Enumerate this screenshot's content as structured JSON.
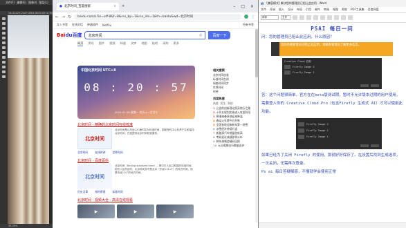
{
  "photoshop": {
    "menu": [
      "文件(F)",
      "编辑(E)",
      "图像(I)",
      "图层(L)",
      "文字(Y)",
      "选择(S)"
    ],
    "doc_title": "34c2a426-2ae0-4964-8b09-857a-3b6fbe57ec70.jpg",
    "zoom": "33.33%",
    "status": "1440 像素 x 2560 像素"
  },
  "browser": {
    "tab_title": "北京时间_百度搜索",
    "url": "baidu.com/s?ie=utf-8&f=8&rsv_bp=1&rsv_idx=1&tn=baidu&wd=北京时间",
    "bookmarks": [
      "导入书签",
      "在线对话",
      "神器插件",
      "Netflix"
    ],
    "bookmarks_right": "所有书签",
    "logo_a": "Bai",
    "logo_b": "du百度",
    "search_value": "北京时间",
    "search_button": "百度一下",
    "nav_tabs": [
      "网页",
      "资讯",
      "图片",
      "视频",
      "知道",
      "文库",
      "地图",
      "贴吧",
      "采购",
      "更多"
    ],
    "clock": {
      "title": "中国北京时间 UTC+8",
      "time": "08 : 20 : 57",
      "date": "2024-01-08 星期一 农历十一月廿七"
    },
    "result1": {
      "title": "北京时间 - 精确的北京时间在线校准",
      "img": "北京时间",
      "text": "北京时间是以东经120度时区为标准时间，国家授时中心负责产生和保持北京时间，在线提供北京时间校准服务。",
      "links": [
        "北京时间",
        "在线时钟",
        "世界时间"
      ]
    },
    "result2": {
      "title": "北京时间 - 百度百科",
      "img": "北京时间",
      "text": "北京时间（Beijing standard time），是中华人民共和国的标准时间，即东八区的区时。北京时间并不是北京（东经116.4°）的地方时间，而是东经120°的地方时间。",
      "links": [
        "历史沿革",
        "授时原理",
        "标准时间"
      ]
    },
    "result3": {
      "title": "北京时间 - 视频大全 - 高清在线观看"
    },
    "side": {
      "section1": "相关搜索",
      "links1": [
        "北京时间校准",
        "标准时间在线",
        "网络时间同步",
        "世界时间",
        "时钟"
      ],
      "section2": "百度热搜",
      "tabs": [
        "热搜",
        "民生",
        "财经"
      ],
      "hot": [
        "让党的创新理论照亮前行之路",
        "十四五规划实施进入攻坚阶段",
        "寒潮来袭多地迎来降温",
        "春运火车票今日开售",
        "全国各地迎来新年第一场雪",
        "冰雪经济持续升温",
        "新能源汽车销量创新高",
        "考研初试成绩即将公布",
        "跨年演唱会精彩回顾",
        "元旦假期出行数据出炉"
      ]
    }
  },
  "word": {
    "title": "[兼容模式] 解决您的管理员已阻止此应用 - Word",
    "menu": [
      "文件",
      "开始",
      "插入",
      "设计",
      "布局",
      "引用",
      "邮件",
      "审阅",
      "视图",
      "帮助",
      "PDF工具集",
      "百度网盘"
    ],
    "font_name": "宋体",
    "font_size": "五号",
    "heading": "PSAI 每日一问",
    "question": "问：您的管理员已阻止此应用，什么原因？",
    "error_text": "您的系统管理员已阻止此应用。请联系管理员了解更多信息。",
    "dialog1_title": "Creative Cloud 应用",
    "dialog1_rows": [
      "Firefly Image 3",
      "Firefly Image 2"
    ],
    "answer": "答：这个问题很简单，官方在在beta版测试期，暂时不允许版本过期的用户使用，需要登入你的 Creative Cloud Pro（包含Firefly 生成式 AI）才可以使用此功能。",
    "dialog2_rows": [
      "Firefly Image 3",
      "Firefly Image 2",
      "Firefly Image 1"
    ],
    "closing": "如果已经为了关闭 Firefly 的使用，那就好好保存了。在设置后找到生成选项，一次关闭，无需再次登录。",
    "footer": "Ps ai 每日答疑解惑，不懂就学会使用正常"
  }
}
